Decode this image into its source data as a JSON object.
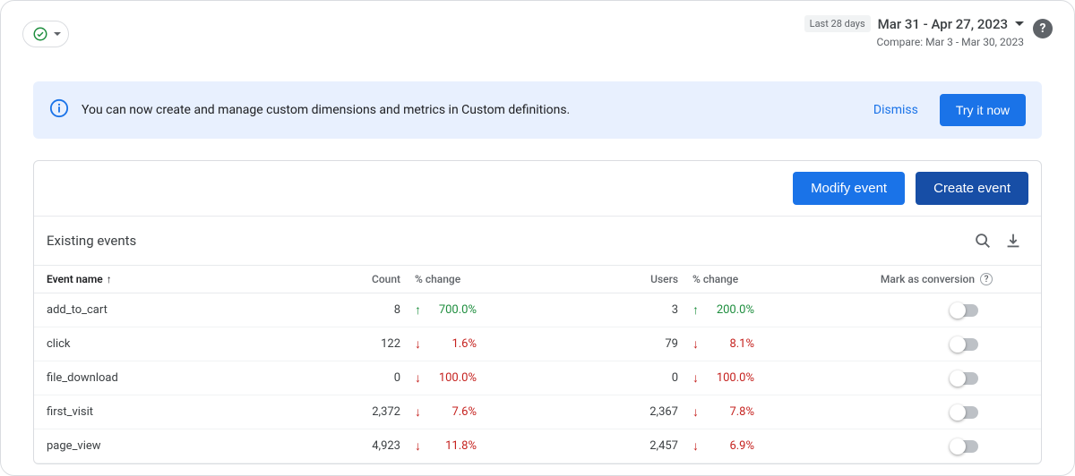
{
  "date": {
    "chip": "Last 28 days",
    "range": "Mar 31 - Apr 27, 2023",
    "compare": "Compare: Mar 3 - Mar 30, 2023"
  },
  "banner": {
    "text": "You can now create and manage custom dimensions and metrics in Custom definitions.",
    "dismiss": "Dismiss",
    "cta": "Try it now"
  },
  "actions": {
    "modify": "Modify event",
    "create": "Create event"
  },
  "section_title": "Existing events",
  "columns": {
    "name": "Event name",
    "count": "Count",
    "cchg": "% change",
    "users": "Users",
    "uchg": "% change",
    "conv": "Mark as conversion"
  },
  "rows": [
    {
      "name": "add_to_cart",
      "count": "8",
      "cdir": "up",
      "cchg": "700.0%",
      "users": "3",
      "udir": "up",
      "uchg": "200.0%"
    },
    {
      "name": "click",
      "count": "122",
      "cdir": "down",
      "cchg": "1.6%",
      "users": "79",
      "udir": "down",
      "uchg": "8.1%"
    },
    {
      "name": "file_download",
      "count": "0",
      "cdir": "down",
      "cchg": "100.0%",
      "users": "0",
      "udir": "down",
      "uchg": "100.0%"
    },
    {
      "name": "first_visit",
      "count": "2,372",
      "cdir": "down",
      "cchg": "7.6%",
      "users": "2,367",
      "udir": "down",
      "uchg": "7.8%"
    },
    {
      "name": "page_view",
      "count": "4,923",
      "cdir": "down",
      "cchg": "11.8%",
      "users": "2,457",
      "udir": "down",
      "uchg": "6.9%"
    }
  ]
}
